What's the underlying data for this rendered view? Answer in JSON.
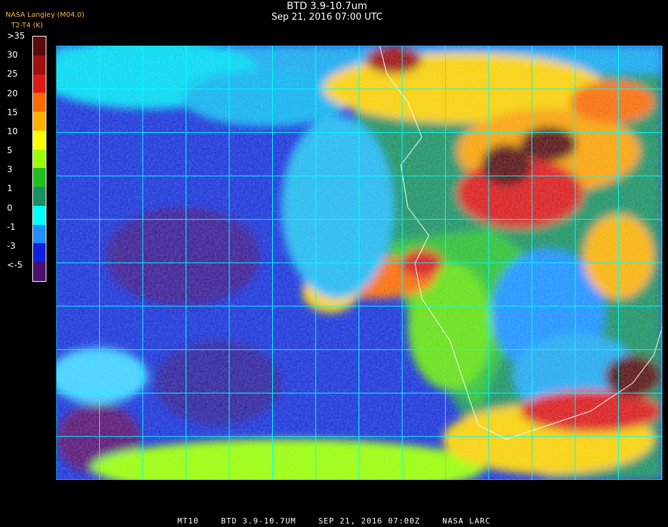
{
  "header": {
    "title": "BTD 3.9-10.7um",
    "subtitle": "Sep 21, 2016 07:00 UTC",
    "credit": "NASA Langley (M04.0)",
    "param_code": "T2-T4",
    "param_units": "(K)"
  },
  "legend": {
    "labels": [
      ">35",
      "30",
      "25",
      "20",
      "15",
      "10",
      "5",
      "3",
      "1",
      "0",
      "-1",
      "-3",
      "<-5"
    ],
    "colors": [
      "#5a0a0a",
      "#a01010",
      "#e01818",
      "#ff6a00",
      "#ffb000",
      "#ffff00",
      "#9cff00",
      "#1fbf1f",
      "#1a8f5f",
      "#00ffff",
      "#1e8fff",
      "#1020e0",
      "#4a1070"
    ]
  },
  "map": {
    "grid_color": "#00ffff",
    "coastline_color": "#ffffff"
  },
  "footer": {
    "satellite": "MT10",
    "product": "BTD 3.9-10.7UM",
    "datetime": "SEP 21, 2016 07:00Z",
    "agency": "NASA LARC"
  }
}
